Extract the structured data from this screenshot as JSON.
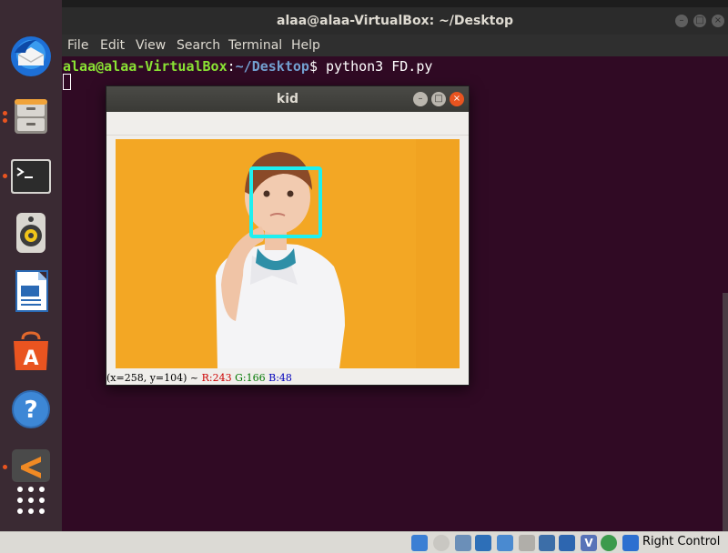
{
  "terminal": {
    "title": "alaa@alaa-VirtualBox: ~/Desktop",
    "menu": [
      "File",
      "Edit",
      "View",
      "Search",
      "Terminal",
      "Help"
    ],
    "prompt_user": "alaa@alaa-VirtualBox",
    "prompt_path": "~/Desktop",
    "prompt_symbol": "$",
    "command": " python3 FD.py"
  },
  "kid_window": {
    "title": "kid",
    "status": {
      "coords": "(x=258, y=104) ~",
      "r": "R:243",
      "g": "G:166",
      "b": "B:48"
    },
    "face_box_color": "#1ef0f0",
    "background_color": "#f3a724"
  },
  "dock": {
    "items": [
      "thunderbird-icon",
      "files-icon",
      "terminal-icon",
      "rhythmbox-icon",
      "writer-icon",
      "software-icon",
      "help-icon",
      "sublime-icon",
      "app-grid-icon"
    ]
  },
  "vbox_status": {
    "host_key_label": "Right Control"
  },
  "colors": {
    "terminal_bg": "#300a24",
    "dock_bg": "#3a2a33",
    "accent": "#e95420"
  }
}
